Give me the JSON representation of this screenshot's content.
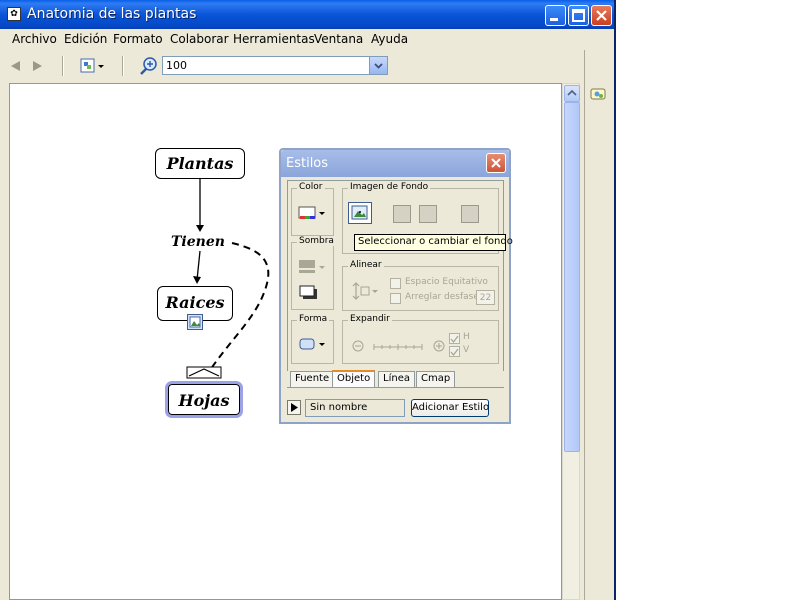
{
  "window": {
    "title": "Anatomia de las plantas"
  },
  "menu": [
    "Archivo",
    "Edición",
    "Formato",
    "Colaborar",
    "Herramientas",
    "Ventana",
    "Ayuda"
  ],
  "toolbar": {
    "zoom_value": "100"
  },
  "map": {
    "nodes": {
      "plantas": "Plantas",
      "raices": "Raices",
      "hojas": "Hojas"
    },
    "link_label": "Tienen"
  },
  "estilos": {
    "title": "Estilos",
    "groups": {
      "color": "Color",
      "imagen": "Imagen de Fondo",
      "sombra": "Sombra",
      "alinear": "Alinear",
      "forma": "Forma",
      "expandir": "Expandir"
    },
    "alinear": {
      "espacio": "Espacio Equitativo",
      "arreglar": "Arreglar desfase",
      "desfase_value": "22"
    },
    "expandir": {
      "h": "H",
      "v": "V"
    },
    "tabs": [
      "Fuente",
      "Objeto",
      "Línea",
      "Cmap"
    ],
    "style_name": "Sin nombre",
    "add_button": "Adicionar Estilo"
  },
  "tooltip": "Seleccionar o cambiar el fondo"
}
